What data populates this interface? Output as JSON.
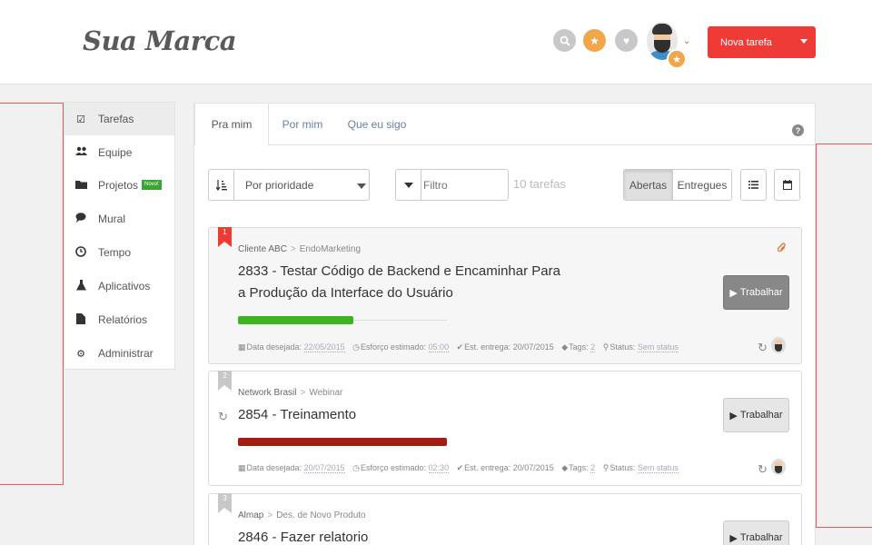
{
  "brand": "Sua Marca",
  "header": {
    "icons": [
      "search-icon",
      "star-icon",
      "heart-icon"
    ],
    "new_task_label": "Nova tarefa"
  },
  "sidebar": {
    "items": [
      {
        "label": "Tarefas",
        "icon": "checkbox-icon",
        "active": true
      },
      {
        "label": "Equipe",
        "icon": "users-icon"
      },
      {
        "label": "Projetos",
        "icon": "folder-icon",
        "badge": "Novo!"
      },
      {
        "label": "Mural",
        "icon": "chat-icon"
      },
      {
        "label": "Tempo",
        "icon": "clock-icon"
      },
      {
        "label": "Aplicativos",
        "icon": "flask-icon"
      },
      {
        "label": "Relatórios",
        "icon": "document-icon"
      },
      {
        "label": "Administrar",
        "icon": "gear-icon"
      }
    ]
  },
  "tabs": [
    {
      "label": "Pra mim",
      "active": true
    },
    {
      "label": "Por mim"
    },
    {
      "label": "Que eu sigo"
    }
  ],
  "toolbar": {
    "sort_value": "Por prioridade",
    "filter_placeholder": "Filtro",
    "count": "10 tarefas",
    "status_open": "Abertas",
    "status_delivered": "Entregues"
  },
  "colors": {
    "accent": "#ef3b36",
    "star": "#f0a64a",
    "progress_green": "#3cb521",
    "progress_red": "#a31c12",
    "link": "#6a7fa2"
  },
  "tasks": [
    {
      "rank": "1",
      "client": "Cliente ABC",
      "project": "EndoMarketing",
      "title": "2833 - Testar Código de Backend e Encaminhar Para a Produção da Interface do Usuário",
      "progress": 0.55,
      "due_label": "Data desejada:",
      "due": "22/05/2015",
      "effort_label": "Esforço estimado:",
      "effort": "05:00",
      "delivery_label": "Est. entrega:",
      "delivery": "20/07/2015",
      "tags_label": "Tags:",
      "tags": "2",
      "status_label": "Status:",
      "status": "Sem status",
      "action": "Trabalhar"
    },
    {
      "rank": "2",
      "client": "Network Brasil",
      "project": "Webinar",
      "title": "2854 - Treinamento",
      "progress": 1.0,
      "due_label": "Data desejada:",
      "due": "20/07/2015",
      "effort_label": "Esforço estimado:",
      "effort": "02:30",
      "delivery_label": "Est. entrega:",
      "delivery": "20/07/2015",
      "tags_label": "Tags:",
      "tags": "2",
      "status_label": "Status:",
      "status": "Sem status",
      "action": "Trabalhar"
    },
    {
      "rank": "3",
      "client": "Almap",
      "project": "Des. de Novo Produto",
      "title": "2846 - Fazer relatorio",
      "action": "Trabalhar"
    }
  ]
}
